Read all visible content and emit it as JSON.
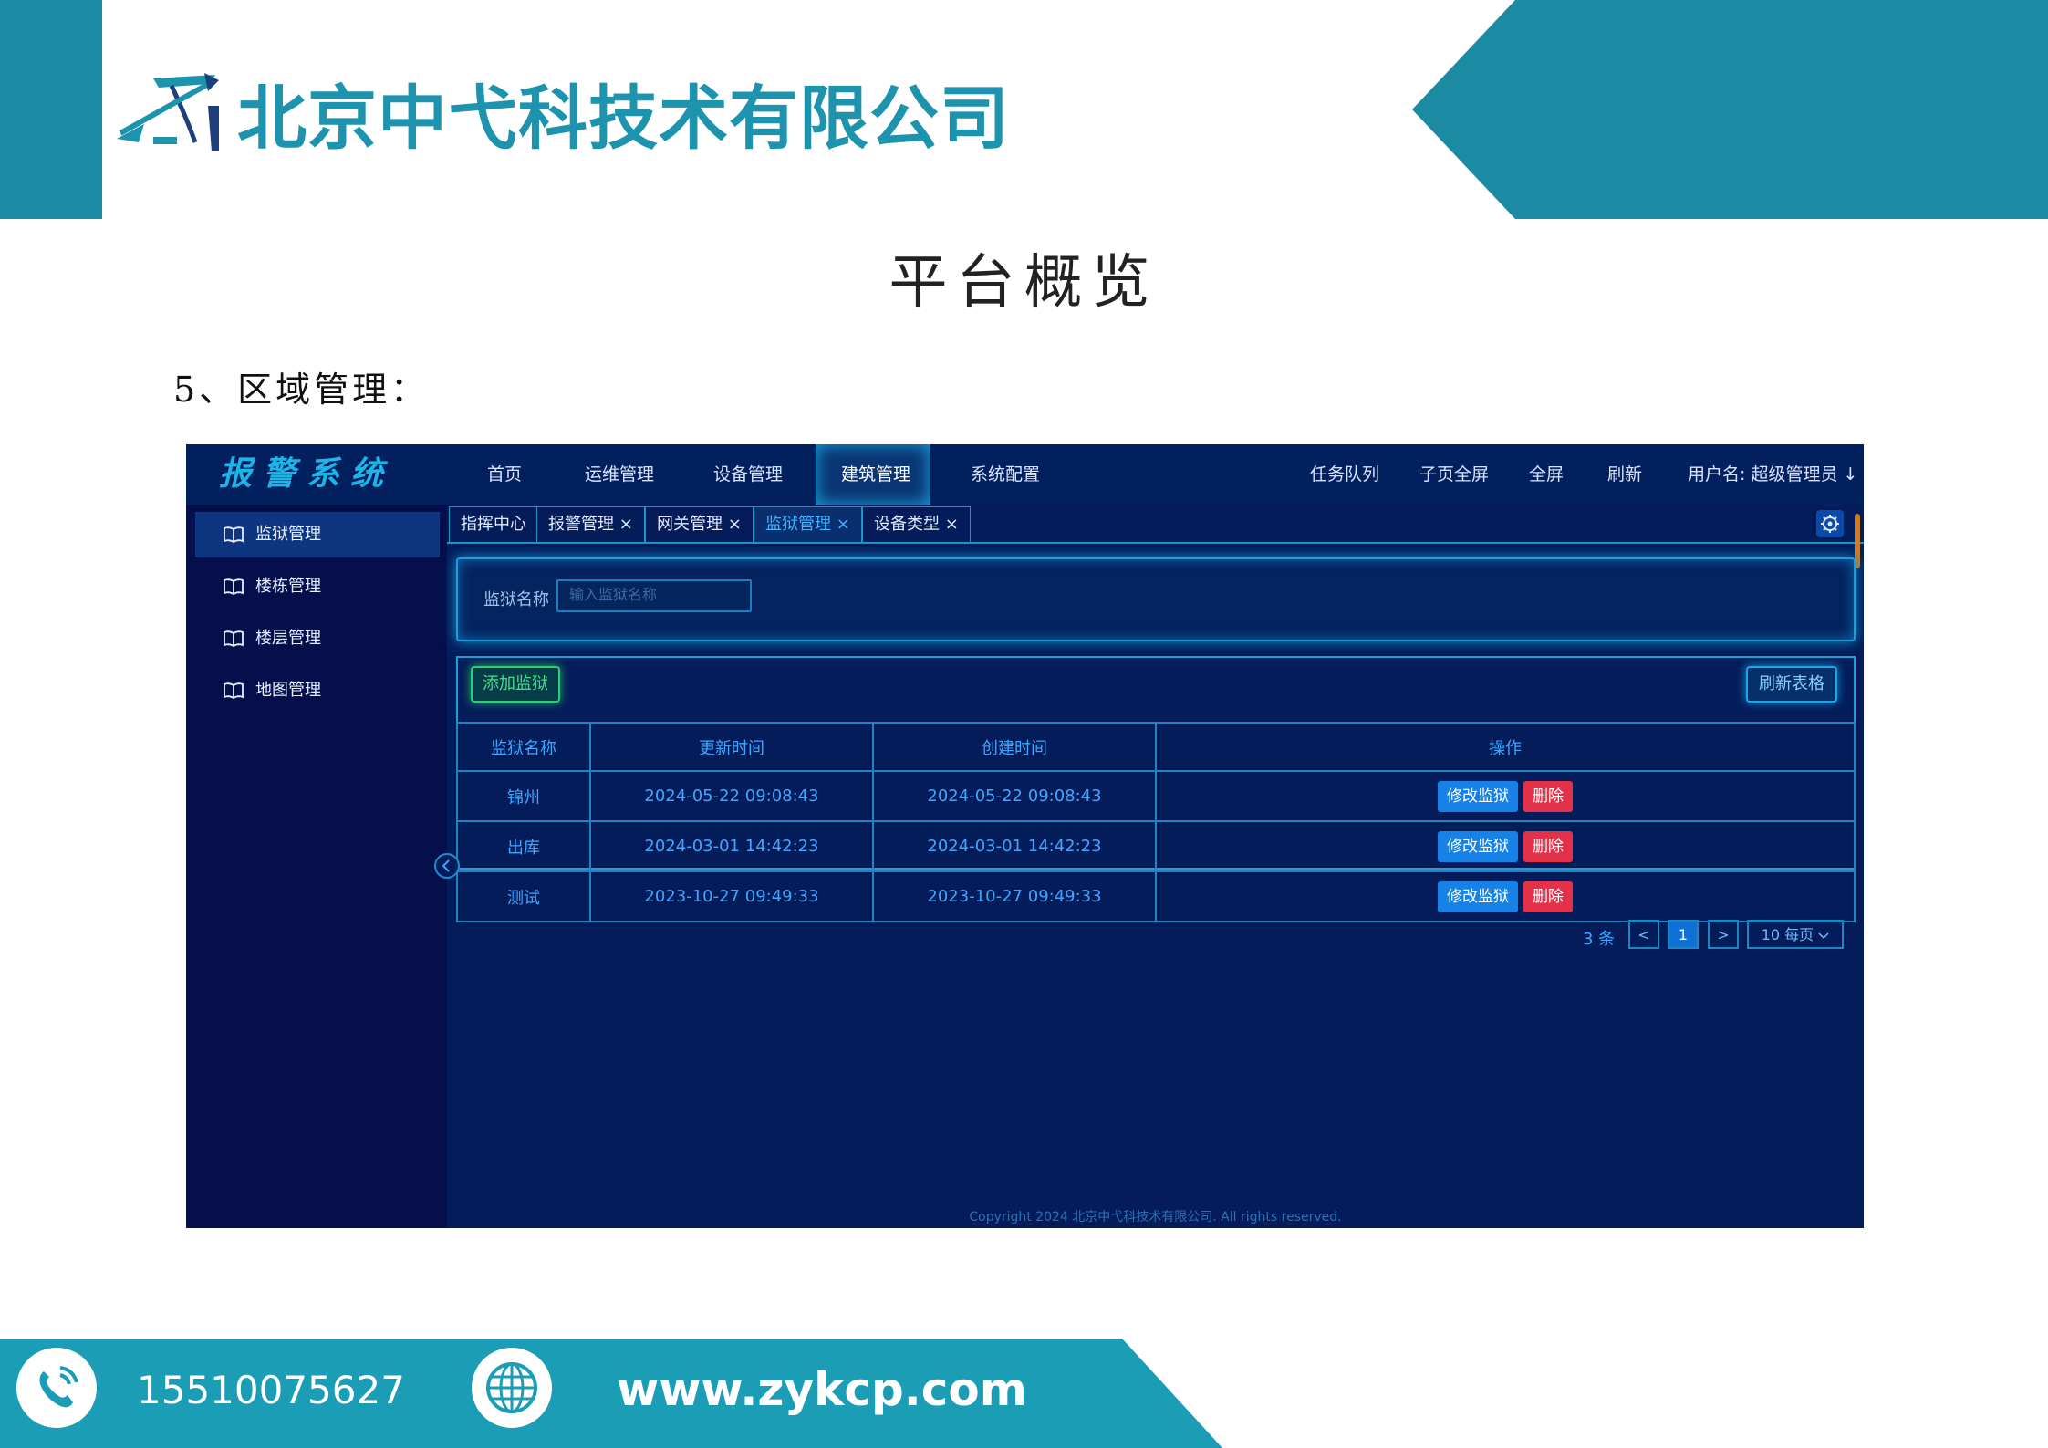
{
  "header": {
    "company": "北京中弋科技术有限公司",
    "page_title": "平台概览",
    "section_heading": "5、区域管理："
  },
  "app": {
    "title": "报警系统",
    "nav": [
      "首页",
      "运维管理",
      "设备管理",
      "建筑管理",
      "系统配置"
    ],
    "nav_active": "建筑管理",
    "right_actions": [
      "任务队列",
      "子页全屏",
      "全屏",
      "刷新",
      "用户名: 超级管理员 ↓"
    ],
    "sidebar": [
      {
        "label": "监狱管理",
        "active": true
      },
      {
        "label": "楼栋管理",
        "active": false
      },
      {
        "label": "楼层管理",
        "active": false
      },
      {
        "label": "地图管理",
        "active": false
      }
    ],
    "tabs": [
      "指挥中心",
      "报警管理 ×",
      "网关管理 ×",
      "监狱管理 ×",
      "设备类型 ×"
    ],
    "active_tab": "监狱管理 ×",
    "search": {
      "label": "监狱名称",
      "placeholder": "输入监狱名称"
    },
    "buttons": {
      "add": "添加监狱",
      "refresh": "刷新表格"
    },
    "table": {
      "headers": [
        "监狱名称",
        "更新时间",
        "创建时间",
        "操作"
      ],
      "rows": [
        {
          "name": "锦州",
          "updated": "2024-05-22 09:08:43",
          "created": "2024-05-22 09:08:43"
        },
        {
          "name": "出库",
          "updated": "2024-03-01 14:42:23",
          "created": "2024-03-01 14:42:23"
        },
        {
          "name": "测试",
          "updated": "2023-10-27 09:49:33",
          "created": "2023-10-27 09:49:33"
        }
      ],
      "edit_label": "修改监狱",
      "delete_label": "删除"
    },
    "pager": {
      "count": "3 条",
      "prev": "<",
      "page": "1",
      "next": ">",
      "size": "10 每页"
    },
    "copyright": "Copyright 2024 北京中弋科技术有限公司. All rights reserved."
  },
  "footer": {
    "phone": "15510075627",
    "website": "www.zykcp.com"
  },
  "colors": {
    "brand_teal": "#1b8ba3",
    "app_bg": "#041d5a",
    "accent_blue": "#1682e8",
    "danger": "#e33149",
    "success": "#2ccf6f"
  }
}
